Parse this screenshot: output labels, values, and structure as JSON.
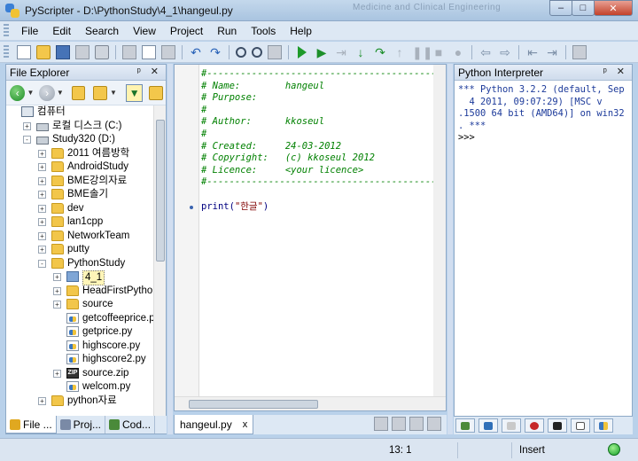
{
  "window": {
    "title": "PyScripter - D:\\PythonStudy\\4_1\\hangeul.py",
    "background_text": "Medicine and Clinical Engineering",
    "controls": [
      "–",
      "□",
      "✕"
    ]
  },
  "menu": [
    "File",
    "Edit",
    "Search",
    "View",
    "Project",
    "Run",
    "Tools",
    "Help"
  ],
  "file_explorer": {
    "title": "File Explorer",
    "header_controls": "ᵖ ✕",
    "tree": [
      {
        "label": "컴퓨터",
        "icon": "computer-icon",
        "level": 0,
        "expander": ""
      },
      {
        "label": "로컬 디스크 (C:)",
        "icon": "drive-icon",
        "level": 1,
        "expander": "+"
      },
      {
        "label": "Study320 (D:)",
        "icon": "drive-icon",
        "level": 1,
        "expander": "-"
      },
      {
        "label": "2011 여름방학",
        "icon": "folder-icon",
        "level": 2,
        "expander": "+"
      },
      {
        "label": "AndroidStudy",
        "icon": "folder-icon",
        "level": 2,
        "expander": "+"
      },
      {
        "label": "BME강의자료",
        "icon": "folder-icon",
        "level": 2,
        "expander": "+"
      },
      {
        "label": "BME솔기",
        "icon": "folder-icon",
        "level": 2,
        "expander": "+"
      },
      {
        "label": "dev",
        "icon": "folder-icon",
        "level": 2,
        "expander": "+"
      },
      {
        "label": "lan1cpp",
        "icon": "folder-icon",
        "level": 2,
        "expander": "+"
      },
      {
        "label": "NetworkTeam",
        "icon": "folder-icon",
        "level": 2,
        "expander": "+"
      },
      {
        "label": "putty",
        "icon": "folder-icon",
        "level": 2,
        "expander": "+"
      },
      {
        "label": "PythonStudy",
        "icon": "folder-icon",
        "level": 2,
        "expander": "-"
      },
      {
        "label": "4_1",
        "icon": "folder-blue-icon",
        "level": 3,
        "expander": "+",
        "selected": true
      },
      {
        "label": "HeadFirstPython",
        "icon": "folder-icon",
        "level": 3,
        "expander": "+"
      },
      {
        "label": "source",
        "icon": "folder-icon",
        "level": 3,
        "expander": "+"
      },
      {
        "label": "getcoffeeprice.py",
        "icon": "python-file-icon",
        "level": 3,
        "expander": ""
      },
      {
        "label": "getprice.py",
        "icon": "python-file-icon",
        "level": 3,
        "expander": ""
      },
      {
        "label": "highscore.py",
        "icon": "python-file-icon",
        "level": 3,
        "expander": ""
      },
      {
        "label": "highscore2.py",
        "icon": "python-file-icon",
        "level": 3,
        "expander": ""
      },
      {
        "label": "source.zip",
        "icon": "zip-file-icon",
        "level": 3,
        "expander": "+"
      },
      {
        "label": "welcom.py",
        "icon": "python-file-icon",
        "level": 3,
        "expander": ""
      },
      {
        "label": "python자료",
        "icon": "folder-icon",
        "level": 2,
        "expander": "+"
      }
    ]
  },
  "left_tabs": [
    {
      "label": "File ...",
      "color": "#e0a820"
    },
    {
      "label": "Proj...",
      "color": "#7a8aa6"
    },
    {
      "label": "Cod...",
      "color": "#4a8a3a"
    }
  ],
  "editor": {
    "lines": [
      {
        "text": "#-----------------------------------------------",
        "kind": "comment"
      },
      {
        "text": "# Name:        hangeul",
        "kind": "comment"
      },
      {
        "text": "# Purpose:",
        "kind": "comment"
      },
      {
        "text": "#",
        "kind": "comment"
      },
      {
        "text": "# Author:      kkoseul",
        "kind": "comment"
      },
      {
        "text": "#",
        "kind": "comment"
      },
      {
        "text": "# Created:     24-03-2012",
        "kind": "comment"
      },
      {
        "text": "# Copyright:   (c) kkoseul 2012",
        "kind": "comment"
      },
      {
        "text": "# Licence:     <your licence>",
        "kind": "comment"
      },
      {
        "text": "#-----------------------------------------------",
        "kind": "comment"
      },
      {
        "text": "",
        "kind": "blank"
      },
      {
        "text": "print(\"한글\")",
        "kind": "code"
      }
    ],
    "print_keyword": "print(",
    "print_string": "\"한글\"",
    "print_close": ")",
    "tab_label": "hangeul.py",
    "tab_close": "x"
  },
  "interpreter": {
    "title": "Python Interpreter",
    "header_controls": "ᵖ ✕",
    "text": "*** Python 3.2.2 (default, Sep\n  4 2011, 09:07:29) [MSC v\n.1500 64 bit (AMD64)] on win32\n. ***",
    "prompt": ">>>"
  },
  "status": {
    "position": "13:  1",
    "mode": "Insert"
  }
}
